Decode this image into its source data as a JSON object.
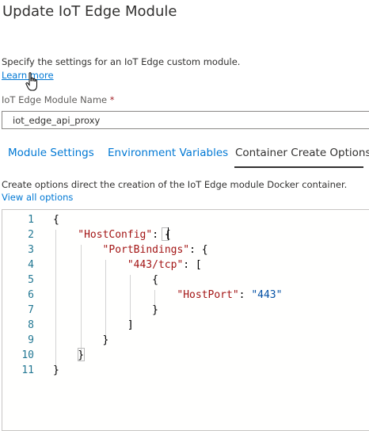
{
  "dialog": {
    "title": "Update IoT Edge Module",
    "description": "Specify the settings for an IoT Edge custom module.",
    "learn_more": "Learn more"
  },
  "module_name": {
    "label": "IoT Edge Module Name",
    "required_marker": "*",
    "value": "iot_edge_api_proxy"
  },
  "tabs": [
    {
      "label": "Module Settings"
    },
    {
      "label": "Environment Variables"
    },
    {
      "label": "Container Create Options"
    }
  ],
  "active_tab": "Container Create Options",
  "create_options": {
    "description": "Create options direct the creation of the IoT Edge module Docker container.",
    "view_all": "View all options"
  },
  "editor": {
    "lines": [
      {
        "num": "1",
        "tokens": [
          {
            "t": "p",
            "v": "{"
          }
        ]
      },
      {
        "num": "2",
        "tokens": [
          {
            "t": "k",
            "v": "\"HostConfig\""
          },
          {
            "t": "p",
            "v": ": {"
          }
        ]
      },
      {
        "num": "3",
        "tokens": [
          {
            "t": "k",
            "v": "\"PortBindings\""
          },
          {
            "t": "p",
            "v": ": {"
          }
        ]
      },
      {
        "num": "4",
        "tokens": [
          {
            "t": "k",
            "v": "\"443/tcp\""
          },
          {
            "t": "p",
            "v": ": ["
          }
        ]
      },
      {
        "num": "5",
        "tokens": [
          {
            "t": "p",
            "v": "{"
          }
        ]
      },
      {
        "num": "6",
        "tokens": [
          {
            "t": "k",
            "v": "\"HostPort\""
          },
          {
            "t": "p",
            "v": ": "
          },
          {
            "t": "s",
            "v": "\"443\""
          }
        ]
      },
      {
        "num": "7",
        "tokens": [
          {
            "t": "p",
            "v": "}"
          }
        ]
      },
      {
        "num": "8",
        "tokens": [
          {
            "t": "p",
            "v": "]"
          }
        ]
      },
      {
        "num": "9",
        "tokens": [
          {
            "t": "p",
            "v": "}"
          }
        ]
      },
      {
        "num": "10",
        "tokens": [
          {
            "t": "p",
            "v": "}"
          }
        ]
      },
      {
        "num": "11",
        "tokens": [
          {
            "t": "p",
            "v": "}"
          }
        ]
      }
    ],
    "colors": {
      "line_number": "#237893",
      "key": "#a31515",
      "string": "#0451a5",
      "punctuation": "#000000"
    }
  },
  "colors": {
    "link": "#0078d4",
    "text": "#323130",
    "required": "#a4262c"
  }
}
